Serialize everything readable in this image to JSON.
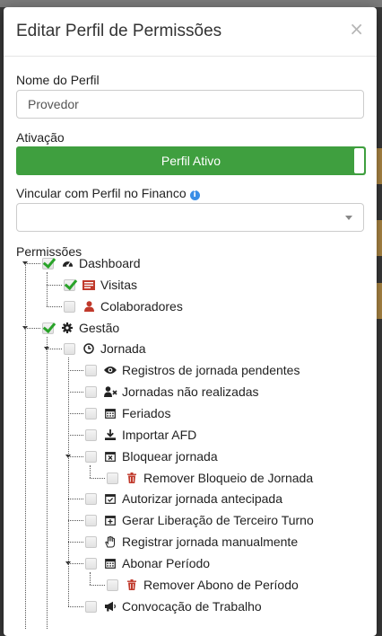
{
  "modal": {
    "title": "Editar Perfil de Permissões",
    "close_label": "×"
  },
  "form": {
    "profile_name_label": "Nome do Perfil",
    "profile_name_value": "Provedor",
    "activation_label": "Ativação",
    "activation_toggle_label": "Perfil Ativo",
    "finance_label": "Vincular com Perfil no Financo",
    "finance_value": "",
    "permissions_label": "Permissões"
  },
  "colors": {
    "toggle_active": "#3f9f3f",
    "check": "#29a329",
    "info_icon": "#3a8ee6",
    "trash_icon": "#c0392b"
  },
  "tree": [
    {
      "id": "dashboard",
      "label": "Dashboard",
      "icon": "dashboard-icon",
      "checked": true
    },
    {
      "id": "visitas",
      "label": "Visitas",
      "icon": "visitas-icon",
      "checked": true
    },
    {
      "id": "colaboradores",
      "label": "Colaboradores",
      "icon": "user-icon",
      "checked": false
    },
    {
      "id": "gestao",
      "label": "Gestão",
      "icon": "gear-icon",
      "checked": true
    },
    {
      "id": "jornada",
      "label": "Jornada",
      "icon": "clock-icon",
      "checked": false
    },
    {
      "id": "registros",
      "label": "Registros de jornada pendentes",
      "icon": "eye-icon",
      "checked": false
    },
    {
      "id": "nao-realizadas",
      "label": "Jornadas não realizadas",
      "icon": "user-x-icon",
      "checked": false
    },
    {
      "id": "feriados",
      "label": "Feriados",
      "icon": "calendar-icon",
      "checked": false
    },
    {
      "id": "importar",
      "label": "Importar AFD",
      "icon": "download-icon",
      "checked": false
    },
    {
      "id": "bloquear",
      "label": "Bloquear jornada",
      "icon": "calendar-x-icon",
      "checked": false
    },
    {
      "id": "remover-bloqueio",
      "label": "Remover Bloqueio de Jornada",
      "icon": "trash-icon",
      "checked": false
    },
    {
      "id": "autorizar",
      "label": "Autorizar jornada antecipada",
      "icon": "calendar-check-icon",
      "checked": false
    },
    {
      "id": "gerar",
      "label": "Gerar Liberação de Terceiro Turno",
      "icon": "calendar-plus-icon",
      "checked": false
    },
    {
      "id": "registrar",
      "label": "Registrar jornada manualmente",
      "icon": "hand-icon",
      "checked": false
    },
    {
      "id": "abonar",
      "label": "Abonar Período",
      "icon": "calendar-icon",
      "checked": false
    },
    {
      "id": "remover-abono",
      "label": "Remover Abono de Período",
      "icon": "trash-icon",
      "checked": false
    },
    {
      "id": "convocacao",
      "label": "Convocação de Trabalho",
      "icon": "megaphone-icon",
      "checked": false
    }
  ]
}
